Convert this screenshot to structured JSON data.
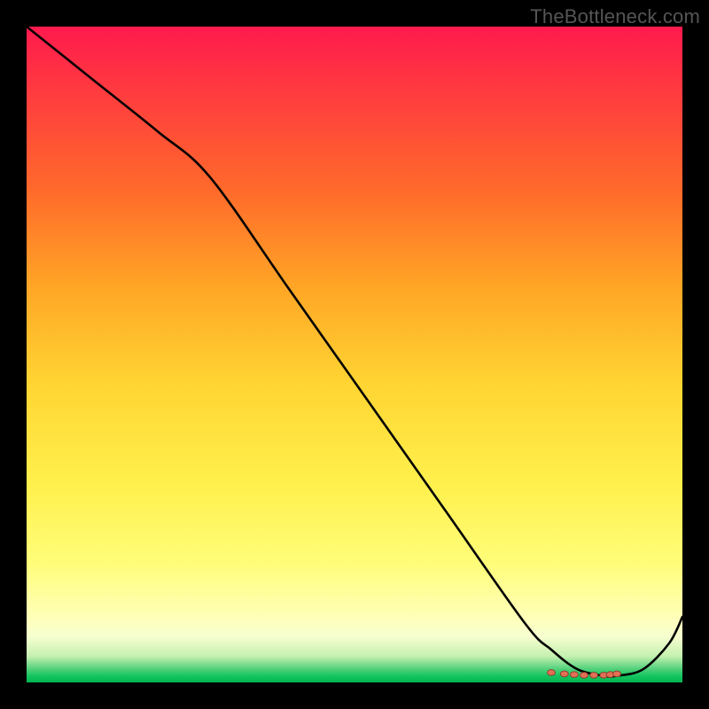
{
  "watermark": "TheBottleneck.com",
  "colors": {
    "line": "#000000",
    "marker_fill": "#e17055",
    "marker_stroke": "#8b3a2a"
  },
  "chart_data": {
    "type": "line",
    "title": "",
    "xlabel": "",
    "ylabel": "",
    "xlim": [
      0,
      100
    ],
    "ylim": [
      0,
      100
    ],
    "x": [
      0,
      10,
      20,
      28,
      40,
      52,
      64,
      76,
      80,
      84,
      88,
      90,
      94,
      98,
      100
    ],
    "values": [
      100,
      92,
      84,
      77,
      60,
      43,
      26,
      9,
      5,
      2,
      1,
      1,
      2,
      6,
      10
    ],
    "markers_x": [
      80,
      82,
      83.5,
      85,
      86.5,
      88,
      89,
      90
    ],
    "markers_y": [
      1.5,
      1.3,
      1.2,
      1.1,
      1.1,
      1.1,
      1.2,
      1.3
    ]
  }
}
